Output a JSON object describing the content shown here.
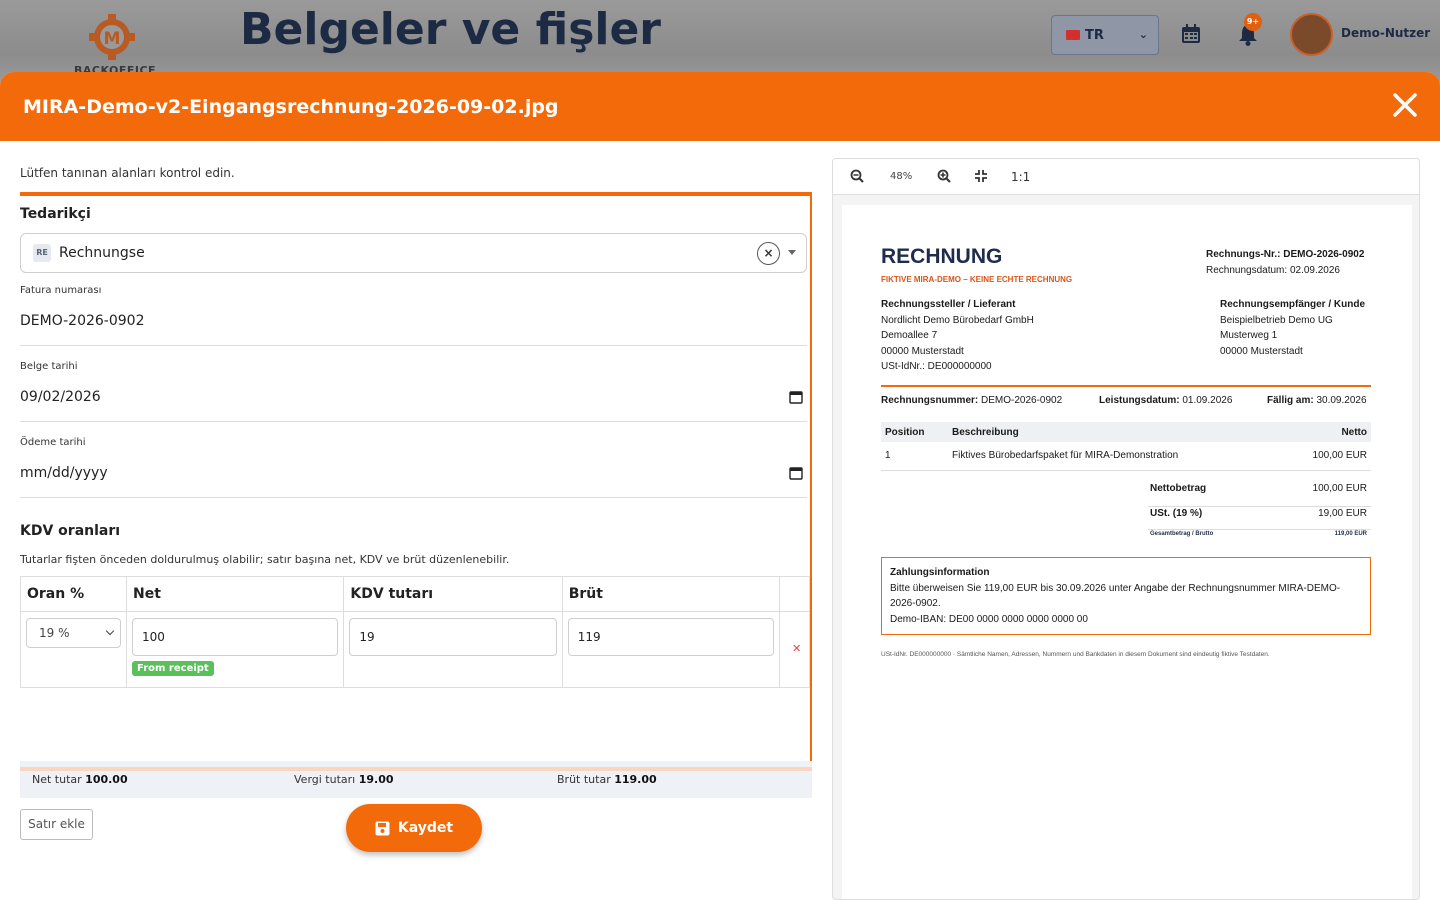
{
  "background": {
    "logo_text": "BACKOFFICE",
    "page_title": "Belgeler ve fişler",
    "language": "TR",
    "notification_count": "9+",
    "user_name": "Demo-Nutzer"
  },
  "modal": {
    "title": "MIRA-Demo-v2-Eingangsrechnung-2026-09-02.jpg",
    "hint": "Lütfen tanınan alanları kontrol edin.",
    "supplier": {
      "label": "Tedarikçi",
      "badge": "RE",
      "value": "Rechnungse"
    },
    "invoice_number": {
      "label": "Fatura numarası",
      "value": "DEMO-2026-0902"
    },
    "document_date": {
      "label": "Belge tarihi",
      "value": "09/02/2026"
    },
    "payment_date": {
      "label": "Ödeme tarihi",
      "value": "mm/dd/yyyy"
    },
    "vat": {
      "title": "KDV oranları",
      "hint": "Tutarlar fişten önceden doldurulmuş olabilir; satır başına net, KDV ve brüt düzenlenebilir.",
      "headers": [
        "Oran %",
        "Net",
        "KDV tutarı",
        "Brüt"
      ],
      "rows": [
        {
          "rate": "19 %",
          "net": "100",
          "vat": "19",
          "gross": "119",
          "source_badge": "From receipt"
        }
      ],
      "totals": {
        "net_label": "Net tutar",
        "net_value": "100.00",
        "tax_label": "Vergi tutarı",
        "tax_value": "19.00",
        "gross_label": "Brüt tutar",
        "gross_value": "119.00"
      },
      "add_row_label": "Satır ekle"
    },
    "save_label": "Kaydet"
  },
  "viewer": {
    "zoom": "48%",
    "actual_size_label": "1:1",
    "document": {
      "title": "RECHNUNG",
      "subtitle": "FIKTIVE MIRA-DEMO – KEINE ECHTE RECHNUNG",
      "meta_number_label": "Rechnungs-Nr.:",
      "meta_number": "DEMO-2026-0902",
      "meta_date": "Rechnungsdatum: 02.09.2026",
      "seller": {
        "heading": "Rechnungssteller / Lieferant",
        "lines": [
          "Nordlicht Demo Bürobedarf GmbH",
          "Demoallee 7",
          "00000 Musterstadt",
          "USt-IdNr.: DE000000000"
        ]
      },
      "buyer": {
        "heading": "Rechnungsempfänger / Kunde",
        "lines": [
          "Beispielbetrieb Demo UG",
          "Musterweg 1",
          "00000 Musterstadt"
        ]
      },
      "info": {
        "number_label": "Rechnungsnummer:",
        "number": "DEMO-2026-0902",
        "service_label": "Leistungsdatum:",
        "service": "01.09.2026",
        "due_label": "Fällig am:",
        "due": "30.09.2026"
      },
      "table_headers": [
        "Position",
        "Beschreibung",
        "Netto"
      ],
      "items": [
        {
          "pos": "1",
          "desc": "Fiktives Bürobedarfspaket für MIRA-Demonstration",
          "net": "100,00 EUR"
        }
      ],
      "sums": {
        "net_label": "Nettobetrag",
        "net": "100,00 EUR",
        "vat_label": "USt. (19 %)",
        "vat": "19,00 EUR",
        "gross_label": "Gesamtbetrag / Brutto",
        "gross": "119,00 EUR"
      },
      "payment": {
        "heading": "Zahlungsinformation",
        "text": "Bitte überweisen Sie 119,00 EUR bis 30.09.2026 unter Angabe der Rechnungsnummer MIRA-DEMO-2026-0902.",
        "iban": "Demo-IBAN: DE00 0000 0000 0000 0000 00"
      },
      "footer": "USt-IdNr. DE000000000 · Sämtliche Namen, Adressen, Nummern und Bankdaten in diesem Dokument sind eindeutig fiktive Testdaten."
    }
  },
  "colors": {
    "accent": "#f36a0b",
    "badge_green": "#5cc05a",
    "navy": "#1f2d4d"
  }
}
